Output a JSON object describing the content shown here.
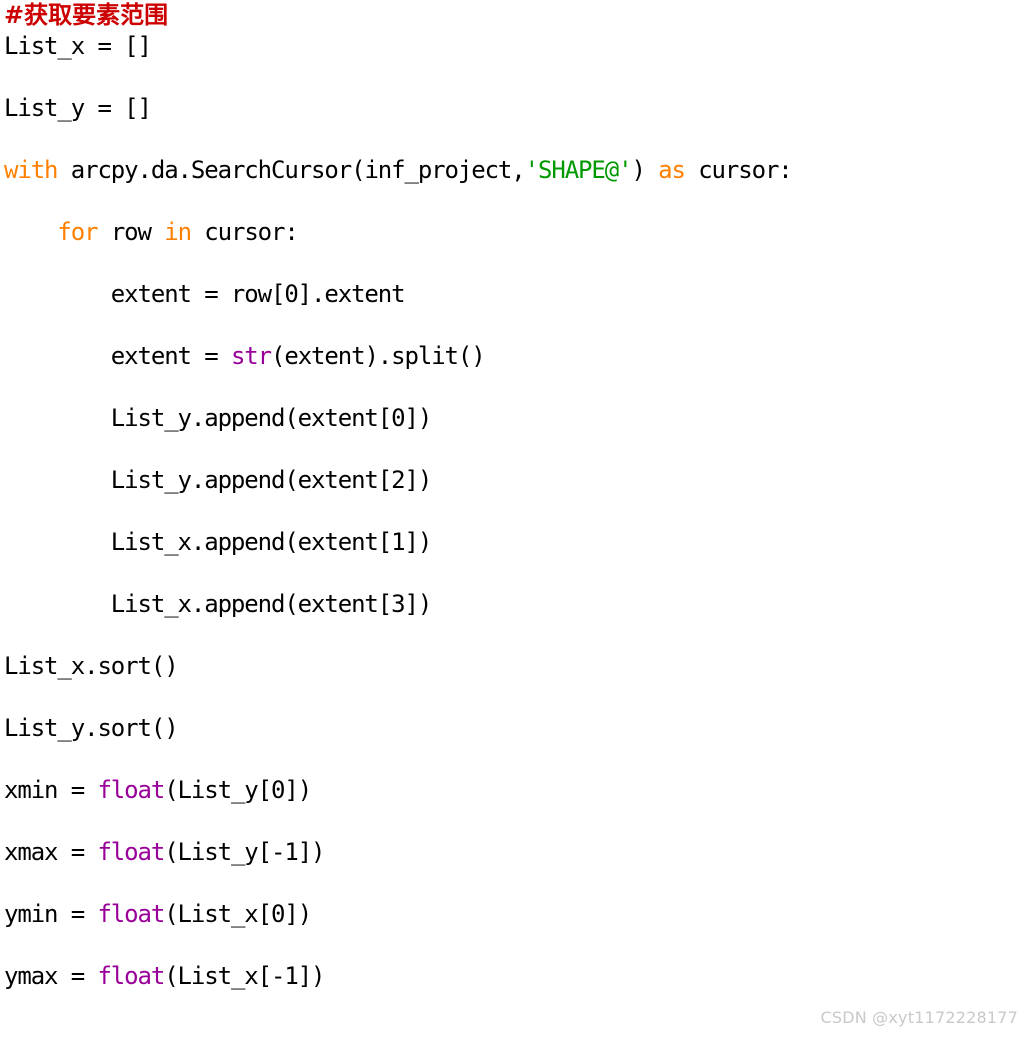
{
  "editor": {
    "language": "python",
    "background_color": "#ffffff",
    "colors": {
      "comment": "#cc0000",
      "keyword": "#ff8000",
      "builtin": "#990099",
      "string": "#009900",
      "plain": "#000000",
      "watermark": "#c9c9c9"
    },
    "lines": [
      {
        "id": "line-1",
        "spacing": "tight",
        "tokens": [
          {
            "t": "comment",
            "v": "#获取要素范围"
          }
        ]
      },
      {
        "id": "line-2",
        "spacing": "tight",
        "tokens": [
          {
            "t": "plain",
            "v": "List_x = []"
          }
        ]
      },
      {
        "id": "line-3",
        "spacing": "spaced",
        "tokens": [
          {
            "t": "plain",
            "v": "List_y = []"
          }
        ]
      },
      {
        "id": "line-4",
        "spacing": "spaced",
        "tokens": [
          {
            "t": "keyword",
            "v": "with"
          },
          {
            "t": "plain",
            "v": " arcpy.da.SearchCursor(inf_project,"
          },
          {
            "t": "string",
            "v": "'SHAPE@'"
          },
          {
            "t": "plain",
            "v": ") "
          },
          {
            "t": "keyword",
            "v": "as"
          },
          {
            "t": "plain",
            "v": " cursor:"
          }
        ]
      },
      {
        "id": "line-5",
        "spacing": "spaced",
        "tokens": [
          {
            "t": "plain",
            "v": "    "
          },
          {
            "t": "keyword",
            "v": "for"
          },
          {
            "t": "plain",
            "v": " row "
          },
          {
            "t": "keyword",
            "v": "in"
          },
          {
            "t": "plain",
            "v": " cursor:"
          }
        ]
      },
      {
        "id": "line-6",
        "spacing": "spaced",
        "tokens": [
          {
            "t": "plain",
            "v": "        extent = row[0].extent"
          }
        ]
      },
      {
        "id": "line-7",
        "spacing": "spaced",
        "tokens": [
          {
            "t": "plain",
            "v": "        extent = "
          },
          {
            "t": "builtin",
            "v": "str"
          },
          {
            "t": "plain",
            "v": "(extent).split()"
          }
        ]
      },
      {
        "id": "line-8",
        "spacing": "spaced",
        "tokens": [
          {
            "t": "plain",
            "v": "        List_y.append(extent[0])"
          }
        ]
      },
      {
        "id": "line-9",
        "spacing": "spaced",
        "tokens": [
          {
            "t": "plain",
            "v": "        List_y.append(extent[2])"
          }
        ]
      },
      {
        "id": "line-10",
        "spacing": "spaced",
        "tokens": [
          {
            "t": "plain",
            "v": "        List_x.append(extent[1])"
          }
        ]
      },
      {
        "id": "line-11",
        "spacing": "spaced",
        "tokens": [
          {
            "t": "plain",
            "v": "        List_x.append(extent[3])"
          }
        ]
      },
      {
        "id": "line-12",
        "spacing": "spaced",
        "tokens": [
          {
            "t": "plain",
            "v": "List_x.sort()"
          }
        ]
      },
      {
        "id": "line-13",
        "spacing": "spaced",
        "tokens": [
          {
            "t": "plain",
            "v": "List_y.sort()"
          }
        ]
      },
      {
        "id": "line-14",
        "spacing": "spaced",
        "tokens": [
          {
            "t": "plain",
            "v": "xmin = "
          },
          {
            "t": "builtin",
            "v": "float"
          },
          {
            "t": "plain",
            "v": "(List_y[0])"
          }
        ]
      },
      {
        "id": "line-15",
        "spacing": "spaced",
        "tokens": [
          {
            "t": "plain",
            "v": "xmax = "
          },
          {
            "t": "builtin",
            "v": "float"
          },
          {
            "t": "plain",
            "v": "(List_y[-1])"
          }
        ]
      },
      {
        "id": "line-16",
        "spacing": "spaced",
        "tokens": [
          {
            "t": "plain",
            "v": "ymin = "
          },
          {
            "t": "builtin",
            "v": "float"
          },
          {
            "t": "plain",
            "v": "(List_x[0])"
          }
        ]
      },
      {
        "id": "line-17",
        "spacing": "spaced",
        "tokens": [
          {
            "t": "plain",
            "v": "ymax = "
          },
          {
            "t": "builtin",
            "v": "float"
          },
          {
            "t": "plain",
            "v": "(List_x[-1])"
          }
        ]
      }
    ]
  },
  "watermark": {
    "text": "CSDN @xyt1172228177"
  }
}
